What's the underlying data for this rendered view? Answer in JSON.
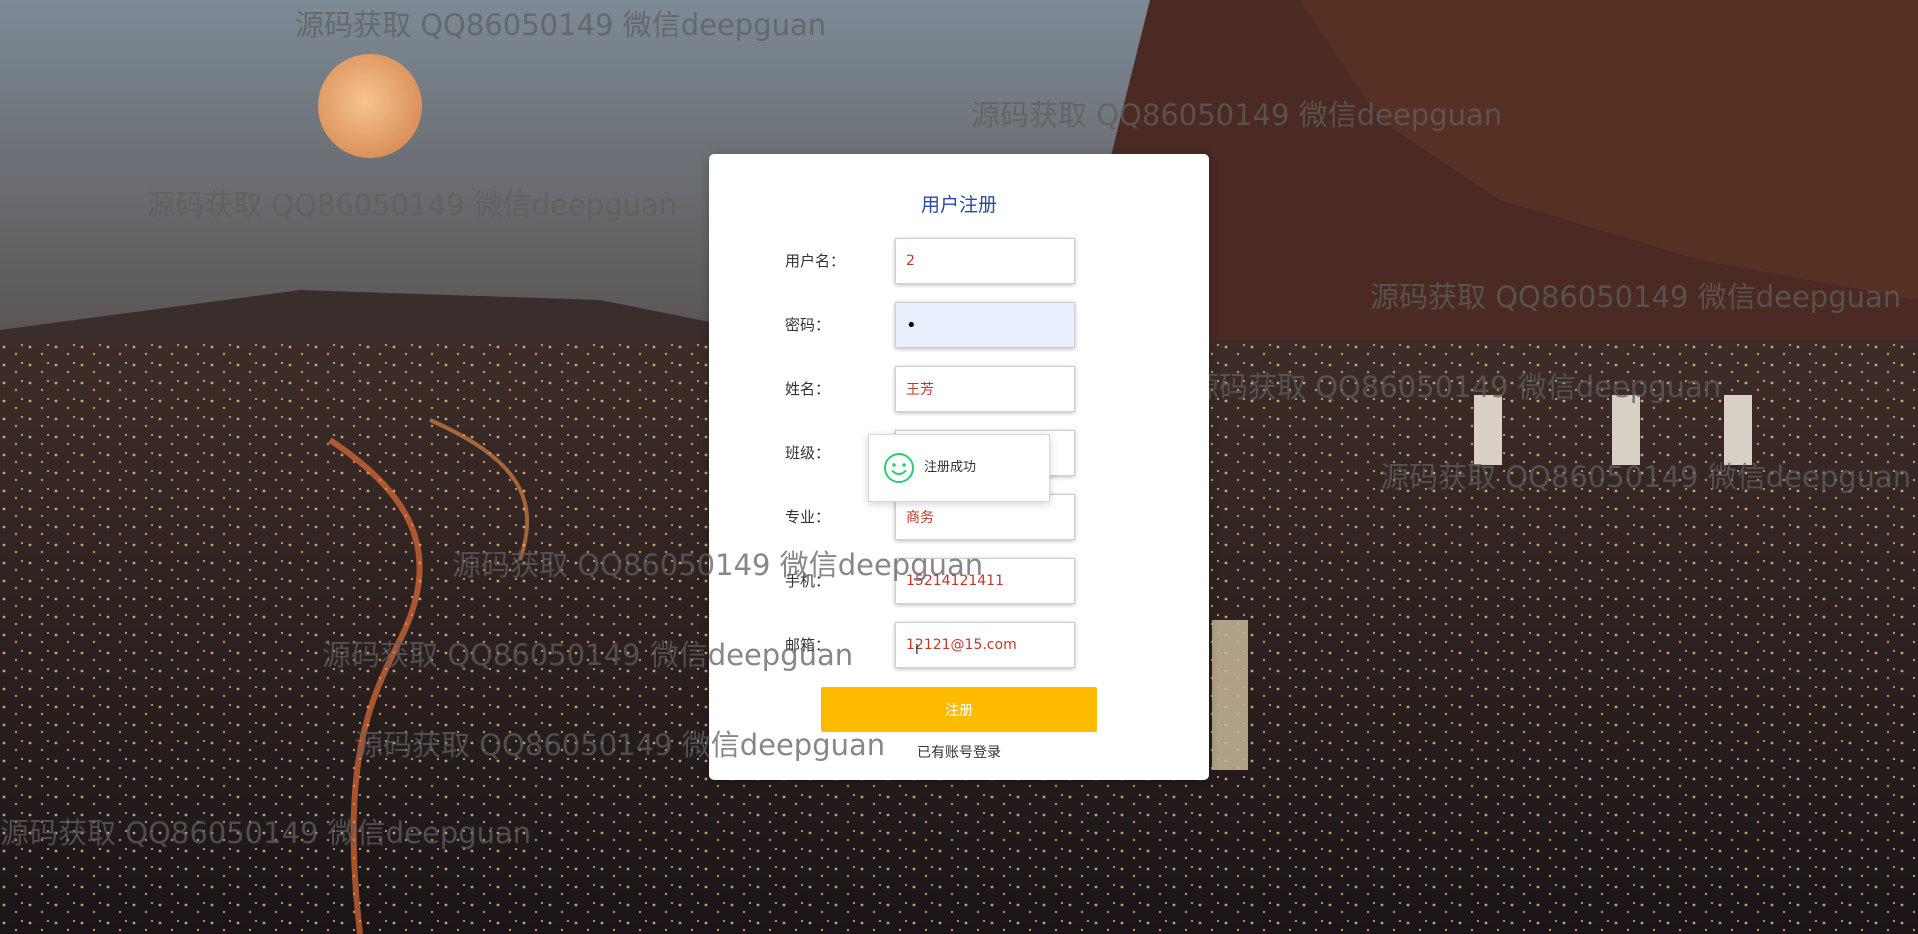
{
  "watermarks": [
    "源码获取 QQ86050149 微信deepguan",
    "源码获取 QQ86050149 微信deepguan",
    "源码获取 QQ86050149 微信deepguan",
    "源码获取 QQ86050149 微信deepguan",
    "源码获取 QQ86050149 微信deepguan",
    "源码获取 QQ86050149 微信deepguan",
    "源码获取 QQ86050149 微信deepguan",
    "源码获取 QQ86050149 微信deepguan",
    "源码获取 QQ86050149 微信deepguan",
    "源码获取 QQ86050149 微信deepguan"
  ],
  "form": {
    "title": "用户注册",
    "fields": [
      {
        "label": "用户名：",
        "value": "2"
      },
      {
        "label": "密码：",
        "value": "•"
      },
      {
        "label": "姓名：",
        "value": "王芳"
      },
      {
        "label": "班级：",
        "value": ""
      },
      {
        "label": "专业：",
        "value": "商务"
      },
      {
        "label": "手机：",
        "value": "15214121411"
      },
      {
        "label": "邮箱：",
        "value": "12121@15.com"
      }
    ],
    "submit_label": "注册",
    "login_link": "已有账号登录"
  },
  "toast": {
    "message": "注册成功",
    "icon": "smile-icon",
    "color": "#2ecc71"
  },
  "colors": {
    "accent": "#ffbb00",
    "title": "#2b4aa0",
    "value_text": "#c0392b"
  }
}
